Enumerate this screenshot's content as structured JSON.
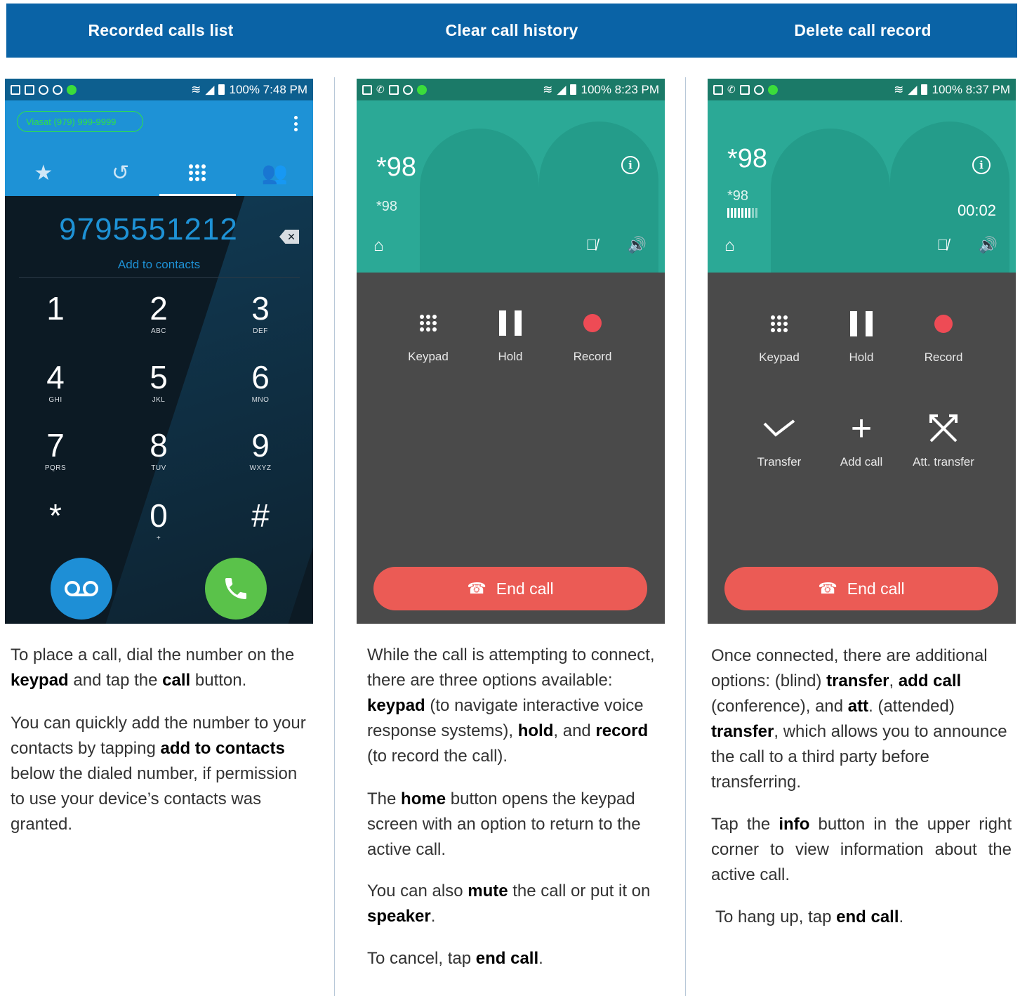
{
  "header": {
    "col1": "Recorded calls list",
    "col2": "Clear call history",
    "col3": "Delete call record",
    "bg_color": "#0a63a6"
  },
  "phone1": {
    "status_right": "100% 7:48 PM",
    "carrier": "Viasat (979) 999-9999",
    "dialed_number": "9795551212",
    "add_to_contacts": "Add to contacts",
    "keys": [
      {
        "digit": "1",
        "letters": ""
      },
      {
        "digit": "2",
        "letters": "ABC"
      },
      {
        "digit": "3",
        "letters": "DEF"
      },
      {
        "digit": "4",
        "letters": "GHI"
      },
      {
        "digit": "5",
        "letters": "JKL"
      },
      {
        "digit": "6",
        "letters": "MNO"
      },
      {
        "digit": "7",
        "letters": "PQRS"
      },
      {
        "digit": "8",
        "letters": "TUV"
      },
      {
        "digit": "9",
        "letters": "WXYZ"
      },
      {
        "digit": "*",
        "letters": ""
      },
      {
        "digit": "0",
        "letters": "+"
      },
      {
        "digit": "#",
        "letters": ""
      }
    ],
    "icons": [
      "star-icon",
      "history-icon",
      "dialpad-icon",
      "contacts-icon",
      "voicemail-icon",
      "phone-icon"
    ]
  },
  "phone2": {
    "status_right": "100% 8:23 PM",
    "number": "*98",
    "sub": "*98",
    "options": [
      "Keypad",
      "Hold",
      "Record"
    ],
    "end_call": "End call"
  },
  "phone3": {
    "status_right": "100% 8:37 PM",
    "number": "*98",
    "sub": "*98",
    "timer": "00:02",
    "options": [
      "Keypad",
      "Hold",
      "Record"
    ],
    "options2": [
      "Transfer",
      "Add call",
      "Att. transfer"
    ],
    "end_call": "End call"
  },
  "text1": {
    "p1": [
      "To place a call, dial the number on the ",
      "keypad",
      " and tap the ",
      "call",
      " button."
    ],
    "p2": [
      "You can quickly add the number to your contacts by tapping ",
      "add to contacts",
      " below the dialed number, if permission to use your device’s contacts was granted."
    ]
  },
  "text2": {
    "p1": [
      "While the call is attempting to connect, there are three options available: ",
      "keypad",
      " (to navigate interactive voice response systems), ",
      "hold",
      ", and ",
      "record",
      " (to record the call)."
    ],
    "p2": [
      "The ",
      "home",
      " button opens the keypad screen with an option to return to the active call."
    ],
    "p3": [
      "You can also ",
      "mute",
      " the call or put it on ",
      "speaker",
      "."
    ],
    "p4": [
      "To cancel, tap ",
      "end call",
      "."
    ]
  },
  "text3": {
    "p1": [
      "Once connected, there are additional options: (blind) ",
      "transfer",
      ", ",
      "add call",
      " (conference), and ",
      "att",
      ". (attended) ",
      "transfer",
      ", which allows you to announce the call to a third party before transferring."
    ],
    "p2": [
      "Tap the ",
      "info",
      " button in the upper right corner to view information about the active call."
    ],
    "p3": [
      "To hang up, tap ",
      "end call",
      "."
    ]
  },
  "colors": {
    "dialer_accent": "#1e92d6",
    "call_green": "#5ac24a",
    "incall_teal": "#2ba996",
    "end_call_red": "#eb5b55",
    "record_red": "#ee4b55"
  }
}
